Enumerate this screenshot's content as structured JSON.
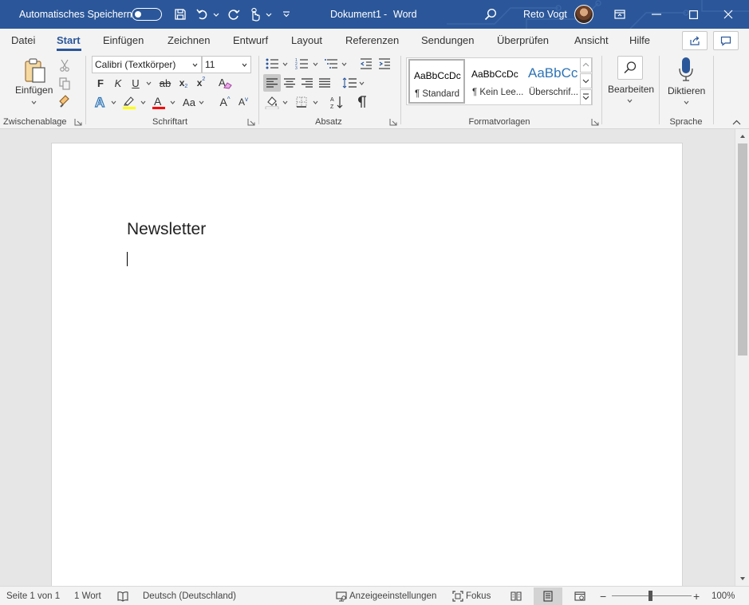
{
  "titlebar": {
    "autosave_label": "Automatisches Speichern",
    "document_title": "Dokument1",
    "separator": "-",
    "app_name": "Word",
    "user_name": "Reto Vogt"
  },
  "tabs": [
    {
      "label": "Datei"
    },
    {
      "label": "Start"
    },
    {
      "label": "Einfügen"
    },
    {
      "label": "Zeichnen"
    },
    {
      "label": "Entwurf"
    },
    {
      "label": "Layout"
    },
    {
      "label": "Referenzen"
    },
    {
      "label": "Sendungen"
    },
    {
      "label": "Überprüfen"
    },
    {
      "label": "Ansicht"
    },
    {
      "label": "Hilfe"
    }
  ],
  "ribbon": {
    "clipboard": {
      "paste_label": "Einfügen",
      "group_label": "Zwischenablage"
    },
    "font": {
      "font_name": "Calibri (Textkörper)",
      "font_size": "11",
      "bold": "F",
      "italic": "K",
      "underline": "U",
      "strikethrough": "ab",
      "subscript": "x",
      "superscript": "x",
      "change_case": "Aa",
      "grow": "A",
      "shrink": "A",
      "group_label": "Schriftart"
    },
    "paragraph": {
      "group_label": "Absatz"
    },
    "styles": {
      "items": [
        {
          "sample": "AaBbCcDc",
          "name": "¶ Standard"
        },
        {
          "sample": "AaBbCcDc",
          "name": "¶ Kein Lee..."
        },
        {
          "sample": "AaBbCc",
          "name": "Überschrif..."
        }
      ],
      "group_label": "Formatvorlagen"
    },
    "editing": {
      "label": "Bearbeiten"
    },
    "voice": {
      "label": "Diktieren",
      "group_label": "Sprache"
    }
  },
  "document": {
    "heading": "Newsletter"
  },
  "statusbar": {
    "page": "Seite 1 von 1",
    "words": "1 Wort",
    "language": "Deutsch (Deutschland)",
    "display_settings": "Anzeigeeinstellungen",
    "focus": "Fokus",
    "zoom": "100%",
    "zoom_level": 1.0
  },
  "colors": {
    "accent": "#2b579a",
    "highlight": "#ffff00",
    "font_color": "#ff0000",
    "text_effect": "#2e75b6"
  }
}
